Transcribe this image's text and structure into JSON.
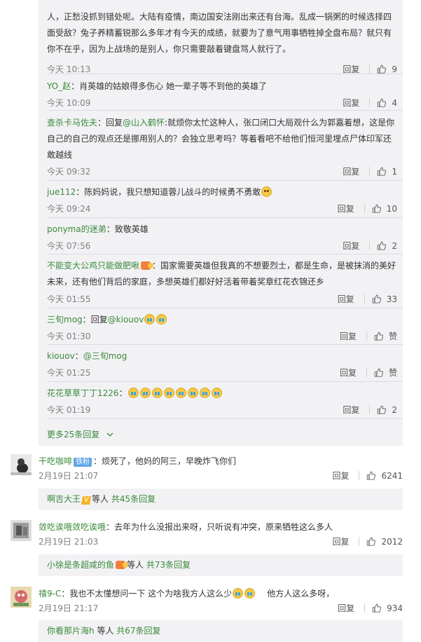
{
  "icons": {
    "like": "thumbs-up-icon",
    "expand": "chevron-down-icon"
  },
  "labels": {
    "reply": "回复",
    "more_replies": "更多25条回复"
  },
  "replies": [
    {
      "text": "人，正愁没抓到错处呢。大陆有疫情，南边国安法刚出来还有台海。乱成一锅粥的时候选择四面受敌？兔子养精蓄锐那么多年才有今天的成绩，就要为了意气用事牺牲掉全盘布局？就只有你不在乎，因为上战场的是别人，你只需要敲着键盘骂人就行了。",
      "time": "今天 10:13",
      "likes": "9"
    },
    {
      "author": "YO_赵",
      "text": "：肖英雄的姑娘得多伤心 她一辈子等不到他的英雄了",
      "time": "今天 10:09",
      "likes": "4"
    },
    {
      "author": "查杀卡马佐夫",
      "reply_prefix": "：回复",
      "mention": "@山入鹤怀",
      "text": ":就烦你太忙这种人，张口闭口大局观什么为郭嘉着想，这是你自己的自己的观点还是挪用别人的？会独立思考吗？等着看吧不给他们恒河里埋点尸体印军还敢越线",
      "time": "今天 09:32",
      "likes": "1"
    },
    {
      "author": "jue112",
      "text": "：陈妈妈说，我只想知道蓉儿战斗的时候勇不勇敢",
      "time": "今天 09:24",
      "likes": "10"
    },
    {
      "author": "ponyma的迷弟",
      "text": "：致敬英雄",
      "time": "今天 07:56",
      "likes": "2"
    },
    {
      "author": "不能变大公鸡只能做肥啾",
      "text": "：国家需要英雄但我真的不想要烈士，都是生命，是被抹消的美好未来，还有他们背后的家庭，多想英雄们都好好活着带着奖章红花衣锦还乡",
      "time": "今天 01:55",
      "likes": "33"
    },
    {
      "author": "三旬mog",
      "reply_prefix": "：回复",
      "mention": "@kiouov",
      "time": "今天 01:30",
      "likes": "赞"
    },
    {
      "author": "kiouov",
      "reply_prefix": "：",
      "mention": "@三旬mog",
      "time": "今天 01:25",
      "likes": "赞"
    },
    {
      "author": "花花草草丁丁1226",
      "text": "：",
      "time": "今天 01:19",
      "likes": "2"
    }
  ],
  "comments": [
    {
      "author": "干吃咖啡",
      "badge": "铁粉",
      "text": "：烦死了，他妈的阿三，早晚炸飞你们",
      "time": "2月19日 21:07",
      "likes": "6241",
      "summary": {
        "name": "啊吉大王",
        "mid": "等人",
        "count": "共45条回复"
      }
    },
    {
      "author": "敛吃诶哦敛吃诶哦",
      "text": "：去年为什么没报出来呀，只听说有冲突，原来牺牲这么多人",
      "time": "2月19日 21:03",
      "likes": "2012",
      "summary": {
        "name": "小徐是条超咸的鱼",
        "mid": "等人",
        "count": "共73条回复"
      }
    },
    {
      "author": "禧9-C",
      "text": "：我也不太懂想问一下  这个为啥我方人这么少",
      "text_tail": "他方人这么多呀，",
      "time": "2月19日 21:17",
      "likes": "934",
      "summary": {
        "name": "你看那片海h",
        "mid": "等人",
        "count": "共67条回复"
      }
    }
  ],
  "colors": {
    "link_green": "#3a8a3a",
    "reply_bg": "#f2f2f5",
    "muted": "#808080"
  }
}
